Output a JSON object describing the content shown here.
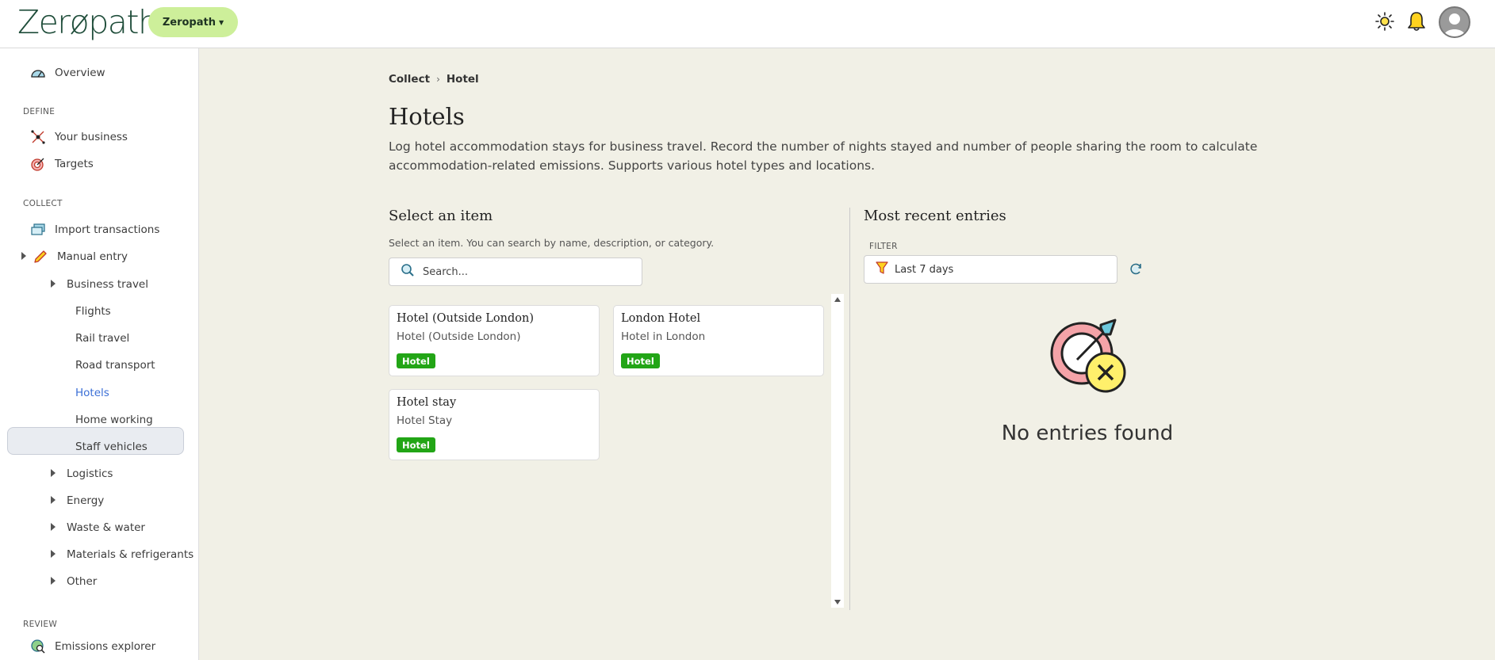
{
  "header": {
    "logo": "Zerøpath",
    "org_button": "Zeropath",
    "icons": [
      "sun-icon",
      "bell-icon",
      "avatar"
    ]
  },
  "sidebar": {
    "overview": "Overview",
    "define_label": "DEFINE",
    "your_business": "Your business",
    "targets": "Targets",
    "collect_label": "COLLECT",
    "import_transactions": "Import transactions",
    "manual_entry": "Manual entry",
    "business_travel": "Business travel",
    "flights": "Flights",
    "rail_travel": "Rail travel",
    "road_transport": "Road transport",
    "hotels": "Hotels",
    "home_working": "Home working",
    "staff_vehicles": "Staff vehicles",
    "logistics": "Logistics",
    "energy": "Energy",
    "waste_water": "Waste & water",
    "materials": "Materials & refrigerants",
    "other": "Other",
    "review_label": "REVIEW",
    "emissions_explorer": "Emissions explorer"
  },
  "breadcrumb": {
    "parent": "Collect",
    "sep": "›",
    "current": "Hotel"
  },
  "page": {
    "title": "Hotels",
    "description": "Log hotel accommodation stays for business travel. Record the number of nights stayed and number of people sharing the room to calculate accommodation-related emissions. Supports various hotel types and locations."
  },
  "select_panel": {
    "title": "Select an item",
    "hint": "Select an item. You can search by name, description, or category.",
    "search_placeholder": "Search...",
    "items": [
      {
        "title": "Hotel (Outside London)",
        "subtitle": "Hotel (Outside London)",
        "badge": "Hotel"
      },
      {
        "title": "London Hotel",
        "subtitle": "Hotel in London",
        "badge": "Hotel"
      },
      {
        "title": "Hotel stay",
        "subtitle": "Hotel Stay",
        "badge": "Hotel"
      }
    ]
  },
  "recent_panel": {
    "title": "Most recent entries",
    "filter_label": "FILTER",
    "filter_value": "Last 7 days",
    "empty_text": "No entries found"
  },
  "colors": {
    "accent_green": "#cdef9a",
    "badge_green": "#22a516",
    "background": "#f1f0e6",
    "active_link": "#3b6fd6"
  }
}
